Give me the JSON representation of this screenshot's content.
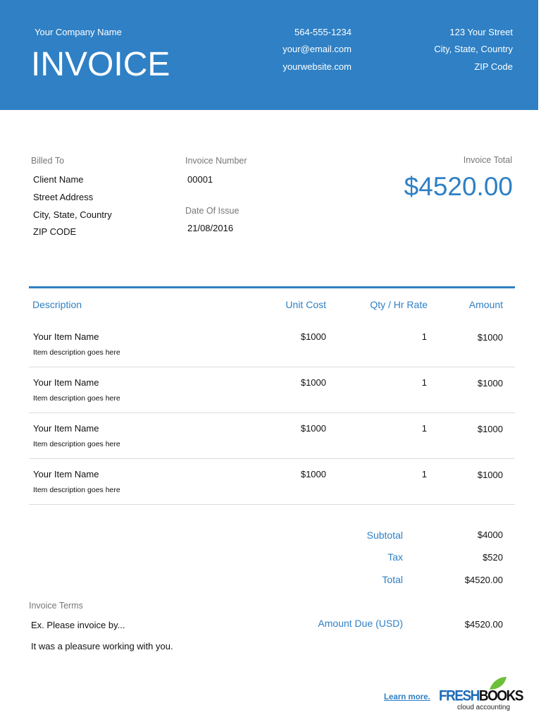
{
  "header": {
    "company": "Your Company Name",
    "title": "INVOICE",
    "phone": "564-555-1234",
    "email": "your@email.com",
    "website": "yourwebsite.com",
    "street": "123 Your Street",
    "city": "City, State, Country",
    "zip": "ZIP Code"
  },
  "billing": {
    "billed_to_label": "Billed To",
    "client": "Client Name",
    "street": "Street Address",
    "city": "City, State, Country",
    "zip": "ZIP CODE",
    "invoice_number_label": "Invoice Number",
    "invoice_number": "00001",
    "date_label": "Date Of Issue",
    "date": "21/08/2016",
    "total_label": "Invoice Total",
    "total": "$4520.00"
  },
  "table": {
    "headers": [
      "Description",
      "Unit Cost",
      "Qty / Hr Rate",
      "Amount"
    ],
    "rows": [
      {
        "name": "Your Item Name",
        "desc": "Item description goes here",
        "cost": "$1000",
        "qty": "1",
        "amount": "$1000"
      },
      {
        "name": "Your Item Name",
        "desc": "Item description goes here",
        "cost": "$1000",
        "qty": "1",
        "amount": "$1000"
      },
      {
        "name": "Your Item Name",
        "desc": "Item description goes here",
        "cost": "$1000",
        "qty": "1",
        "amount": "$1000"
      },
      {
        "name": "Your Item Name",
        "desc": "Item description goes here",
        "cost": "$1000",
        "qty": "1",
        "amount": "$1000"
      }
    ]
  },
  "totals": {
    "subtotal_label": "Subtotal",
    "subtotal": "$4000",
    "tax_label": "Tax",
    "tax": "$520",
    "total_label": "Total",
    "total": "$4520.00",
    "due_label": "Amount Due (USD)",
    "due": "$4520.00"
  },
  "terms": {
    "label": "Invoice Terms",
    "line1": "Ex. Please invoice by...",
    "line2": "It was a pleasure working with you."
  },
  "footer": {
    "learn_more": "Learn more.",
    "logo_fresh": "FRESH",
    "logo_books": "BOOKS",
    "logo_tag": "cloud accounting"
  }
}
